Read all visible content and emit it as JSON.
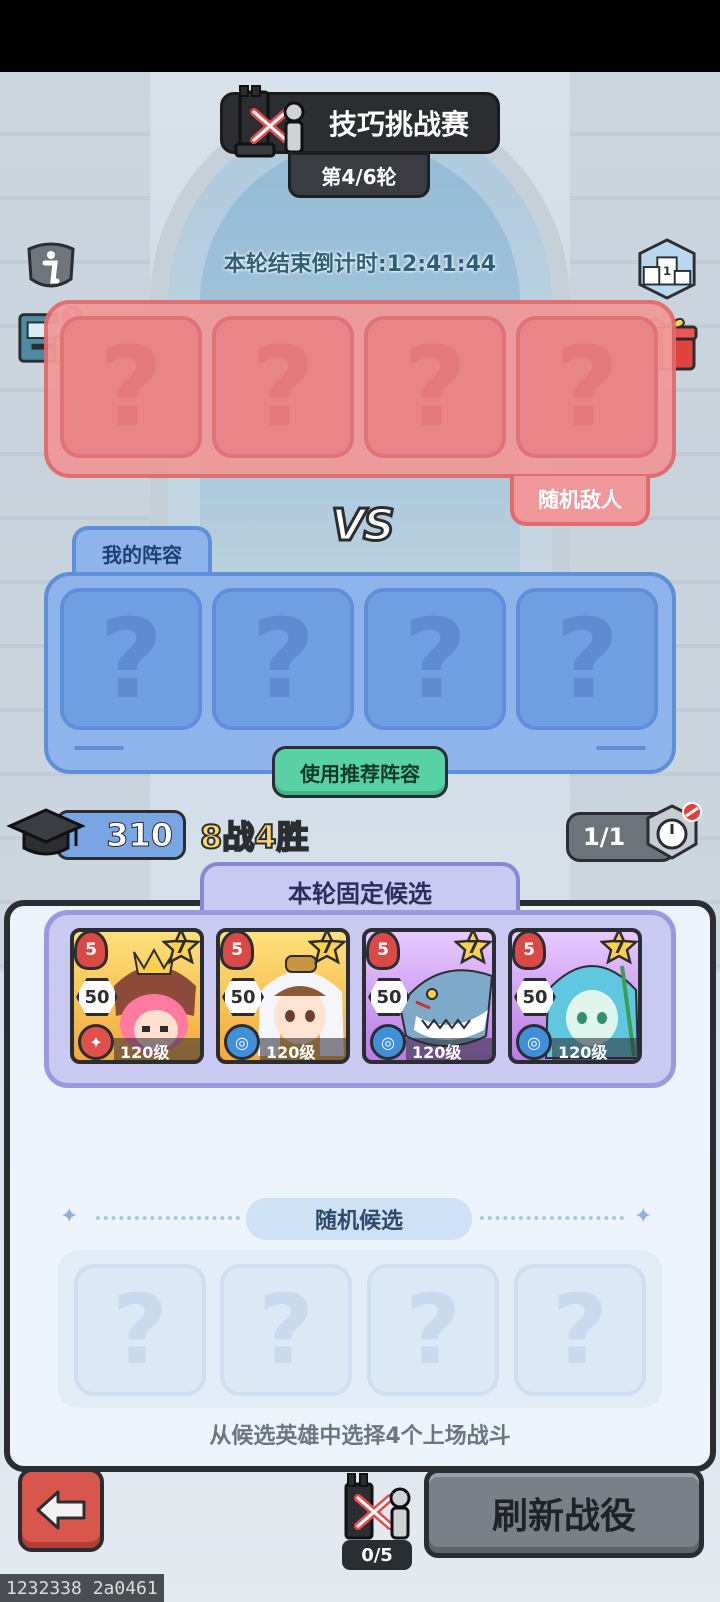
{
  "header": {
    "title": "技巧挑战赛",
    "round": "第4/6轮",
    "countdown": "本轮结束倒计时:12:41:44"
  },
  "side_icons": {
    "info": "info-icon",
    "log_badge": "1",
    "ranking": "ranking-podium-icon",
    "gift": "gift-icon"
  },
  "enemy": {
    "slots": [
      "?",
      "?",
      "?",
      "?"
    ],
    "tag": "随机敌人"
  },
  "vs_label": "VS",
  "my_team": {
    "tab": "我的阵容",
    "slots": [
      "?",
      "?",
      "?",
      "?"
    ],
    "recommend_button": "使用推荐阵容"
  },
  "stats": {
    "score": "310",
    "record": "8战4胜",
    "attempts": "1/1"
  },
  "candidates": {
    "fixed_tab": "本轮固定候选",
    "heroes": [
      {
        "stars": "5",
        "grade": "7",
        "power": "50",
        "level": "120级",
        "element": "fire"
      },
      {
        "stars": "5",
        "grade": "7",
        "power": "50",
        "level": "120级",
        "element": "water"
      },
      {
        "stars": "5",
        "grade": "7",
        "power": "50",
        "level": "120级",
        "element": "water"
      },
      {
        "stars": "5",
        "grade": "7",
        "power": "50",
        "level": "120级",
        "element": "water"
      }
    ],
    "random_label": "随机候选",
    "random_slots": [
      "?",
      "?",
      "?",
      "?"
    ],
    "hint": "从候选英雄中选择4个上场战斗"
  },
  "footer": {
    "ticket_count": "0/5",
    "refresh_button": "刷新战役"
  },
  "build_id": "1232338 2a0461",
  "colors": {
    "enemy": "#f09899",
    "ally": "#8fb4ec",
    "recommend": "#58d2a4",
    "candidate": "#c9c9f2"
  }
}
